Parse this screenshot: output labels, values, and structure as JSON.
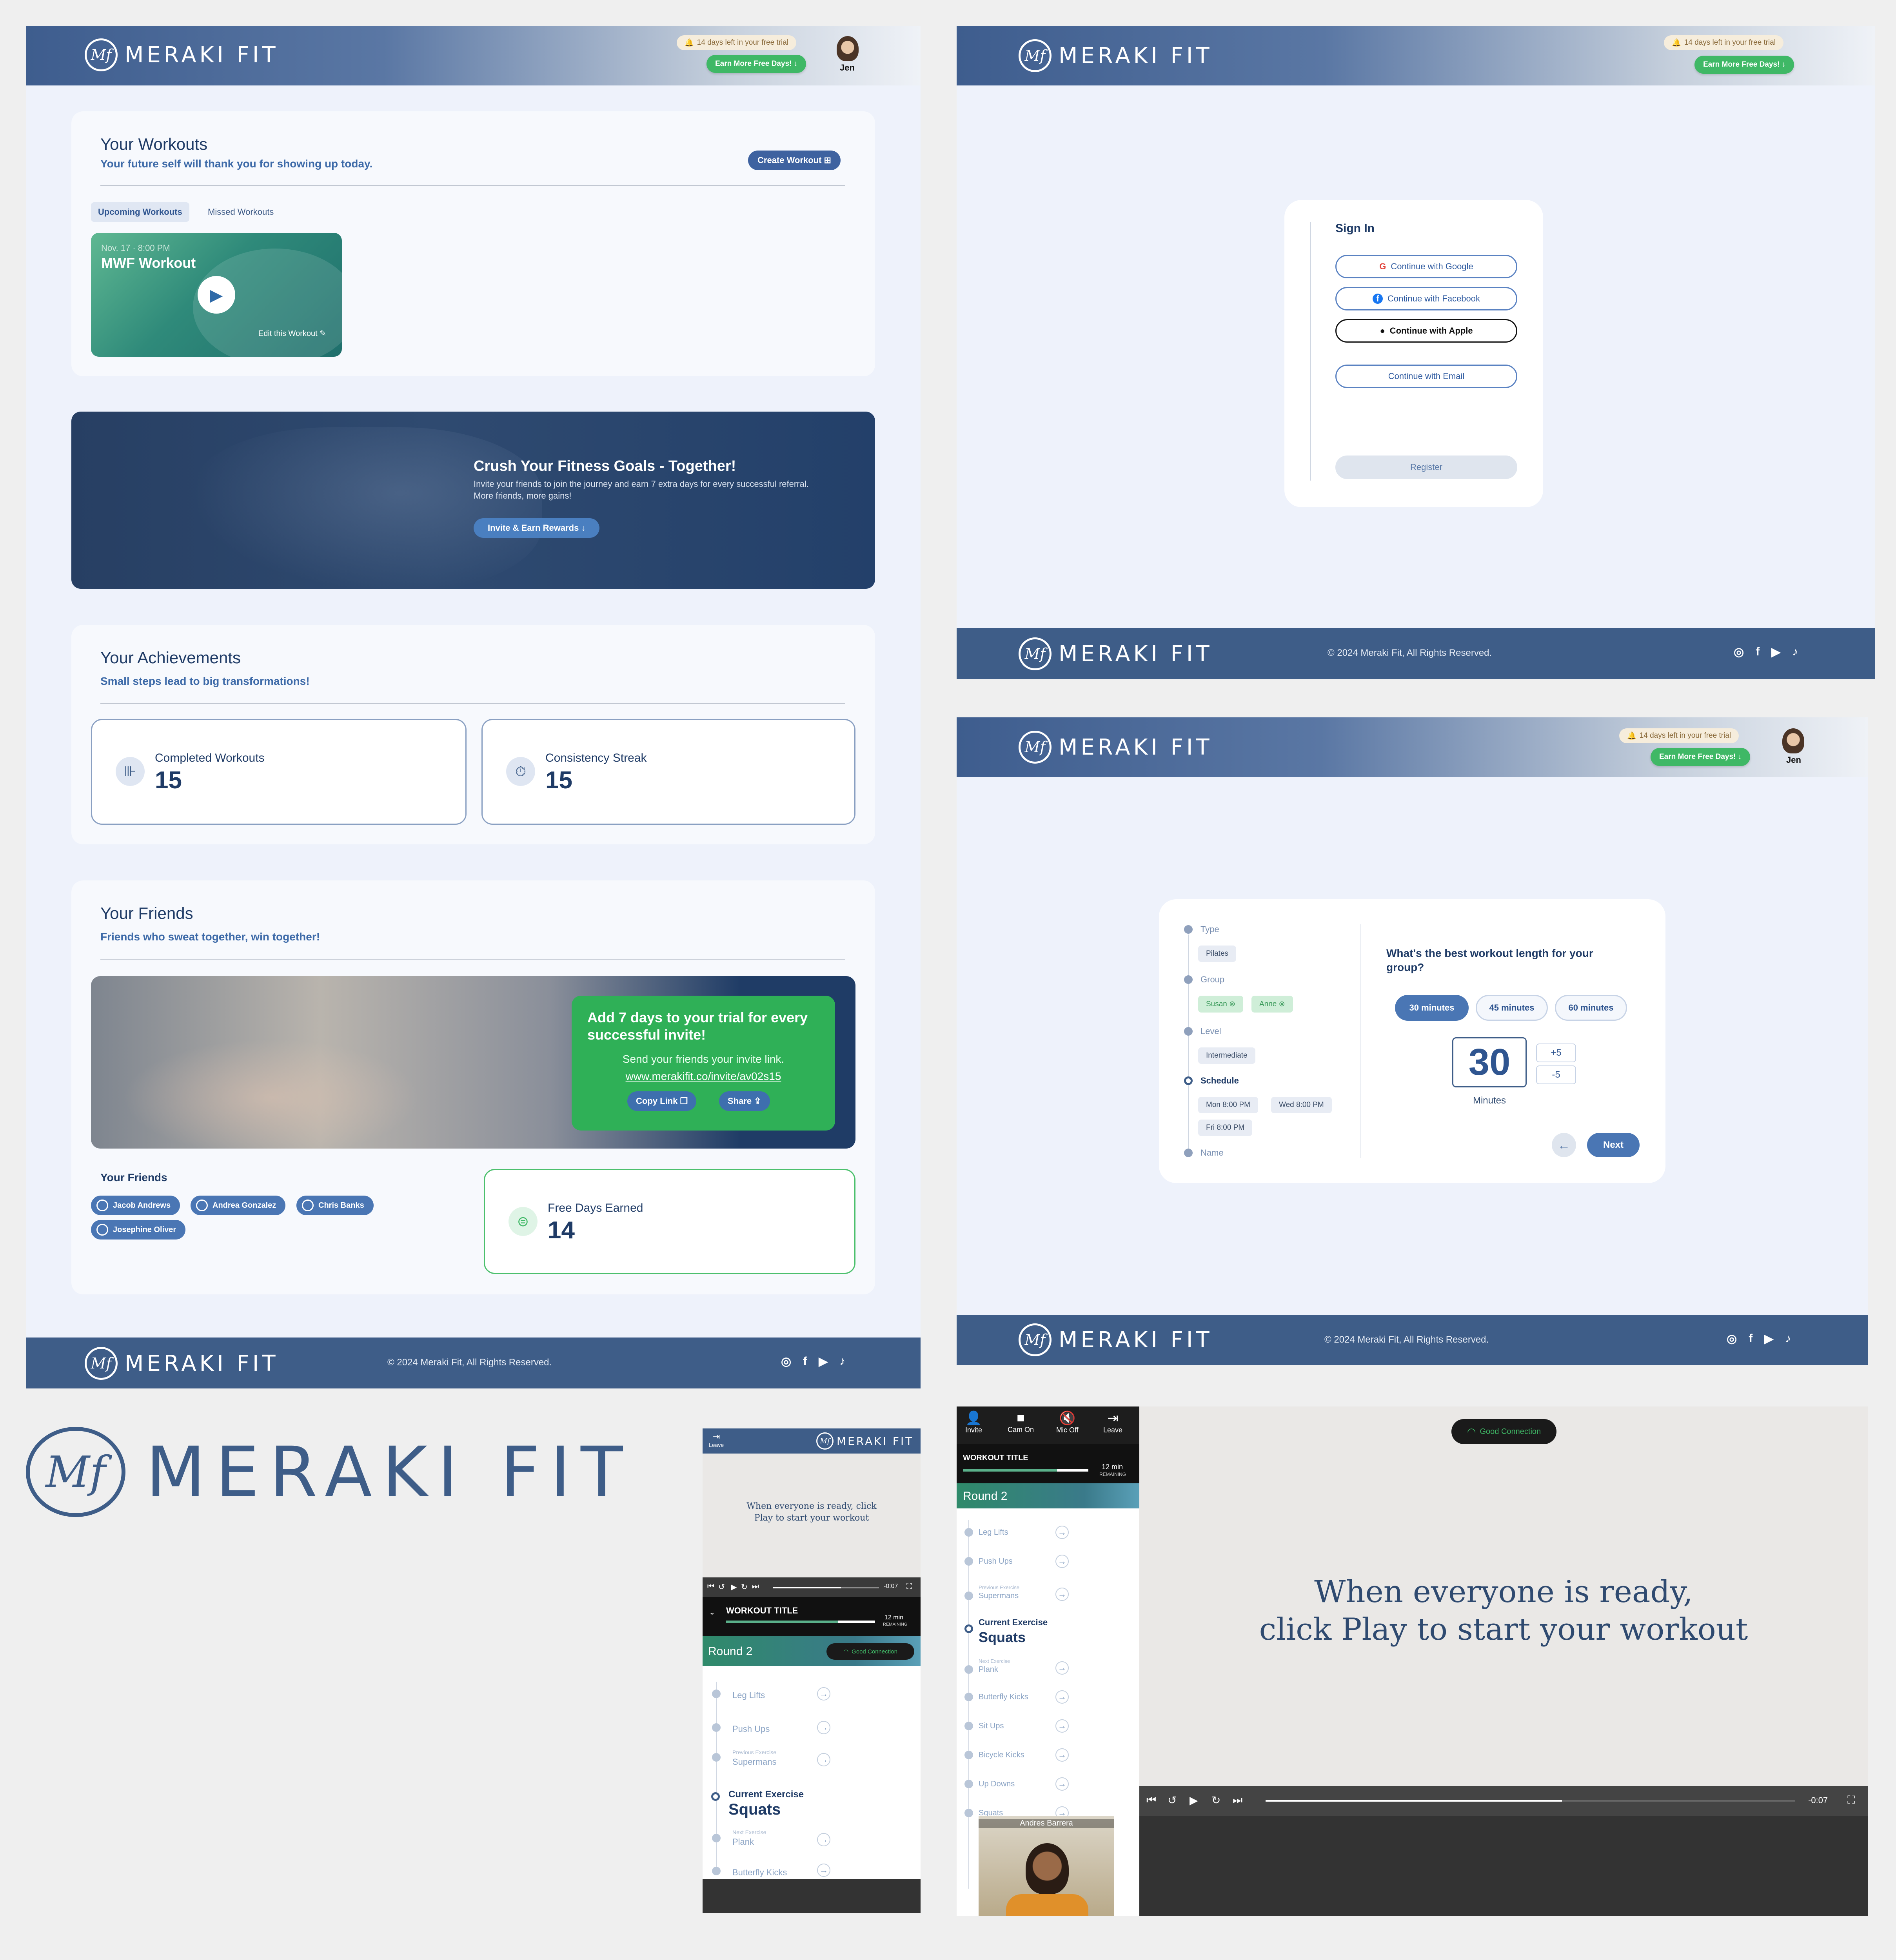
{
  "brand": {
    "name": "MERAKI FIT",
    "mark": "Mf",
    "color": "#3e5d88",
    "accent_green": "#3fb866"
  },
  "header": {
    "trial_text": "14 days left in your free trial",
    "earn_button": "Earn More Free Days! ↓",
    "user_name": "Jen"
  },
  "footer": {
    "copyright": "© 2024 Meraki Fit, All Rights Reserved.",
    "social_icons": [
      "instagram-icon",
      "facebook-icon",
      "youtube-icon",
      "tiktok-icon"
    ]
  },
  "dashboard": {
    "workouts": {
      "title": "Your Workouts",
      "subtitle": "Your future self will thank you for showing up today.",
      "create_button": "Create Workout",
      "tabs": [
        "Upcoming Workouts",
        "Missed Workouts"
      ],
      "card": {
        "date": "Nov. 17  ·  8:00 PM",
        "name": "MWF Workout",
        "edit": "Edit this Workout"
      }
    },
    "banner": {
      "title": "Crush Your Fitness Goals - Together!",
      "text": "Invite your friends to join the journey and earn 7 extra days for every successful referral. More friends, more gains!",
      "button": "Invite & Earn Rewards ↓"
    },
    "achievements": {
      "title": "Your Achievements",
      "subtitle": "Small steps lead to big transformations!",
      "stats": [
        {
          "label": "Completed Workouts",
          "value": "15",
          "icon": "dumbbell-icon"
        },
        {
          "label": "Consistency Streak",
          "value": "15",
          "icon": "timer-icon"
        }
      ]
    },
    "friends": {
      "title": "Your Friends",
      "subtitle": "Friends who sweat together, win together!",
      "invite_title": "Add 7 days to your trial for every successful invite!",
      "invite_text": "Send your friends your invite link.",
      "invite_link": "www.merakifit.co/invite/av02s15",
      "copy_button": "Copy Link",
      "share_button": "Share",
      "list_title": "Your Friends",
      "list": [
        "Jacob Andrews",
        "Andrea Gonzalez",
        "Chris Banks",
        "Josephine Oliver"
      ],
      "free_days_label": "Free Days Earned",
      "free_days_value": "14"
    }
  },
  "signin": {
    "title": "Sign In",
    "buttons": [
      "Continue with Google",
      "Continue with Facebook",
      "Continue with Apple",
      "Continue with Email"
    ],
    "register": "Register"
  },
  "wizard": {
    "steps": [
      {
        "label": "Type",
        "value": "Pilates"
      },
      {
        "label": "Group",
        "chips": [
          "Susan",
          "Anne"
        ]
      },
      {
        "label": "Level",
        "value": "Intermediate"
      },
      {
        "label": "Schedule",
        "options": [
          "Mon 8:00 PM",
          "Wed 8:00 PM",
          "Fri 8:00 PM"
        ]
      },
      {
        "label": "Name"
      }
    ],
    "question": "What's the best workout length for your group?",
    "durations": [
      "30 minutes",
      "45 minutes",
      "60 minutes"
    ],
    "selected_duration": 0,
    "value": "30",
    "unit": "Minutes",
    "plus": "+5",
    "minus": "-5",
    "next": "Next"
  },
  "logo_large": "MERAKI FIT",
  "mobile": {
    "leave": "Leave",
    "message": "When everyone is ready, click Play to start your workout",
    "time": "-0:07",
    "workout_title": "WORKOUT TITLE",
    "remaining_value": "12 min",
    "remaining_label": "REMAINING",
    "round": "Round 2",
    "connection": "Good Connection",
    "exercises": [
      {
        "name": "Leg Lifts"
      },
      {
        "name": "Push Ups"
      },
      {
        "pre": "Previous Exercise",
        "name": "Supermans"
      },
      {
        "pre": "Current Exercise",
        "name": "Squats",
        "current": true
      },
      {
        "pre": "Next Exercise",
        "name": "Plank"
      },
      {
        "name": "Butterfly Kicks"
      }
    ]
  },
  "desktop_session": {
    "toolbar": [
      "Invite",
      "Cam On",
      "Mic Off",
      "Leave"
    ],
    "workout_title": "WORKOUT TITLE",
    "remaining_value": "12 min",
    "remaining_label": "REMAINING",
    "round": "Round 2",
    "connection": "Good Connection",
    "message_line1": "When everyone is ready,",
    "message_line2": "click Play to start your workout",
    "time": "-0:07",
    "participant": "Andres Barrera",
    "progress": 0.56,
    "exercises": [
      {
        "name": "Leg Lifts"
      },
      {
        "name": "Push Ups"
      },
      {
        "pre": "Previous Exercise",
        "name": "Supermans"
      },
      {
        "pre": "Current Exercise",
        "name": "Squats",
        "current": true
      },
      {
        "pre": "Next Exercise",
        "name": "Plank"
      },
      {
        "name": "Butterfly Kicks"
      },
      {
        "name": "Sit Ups"
      },
      {
        "name": "Bicycle Kicks"
      },
      {
        "name": "Up Downs"
      },
      {
        "name": "Squats"
      }
    ]
  }
}
